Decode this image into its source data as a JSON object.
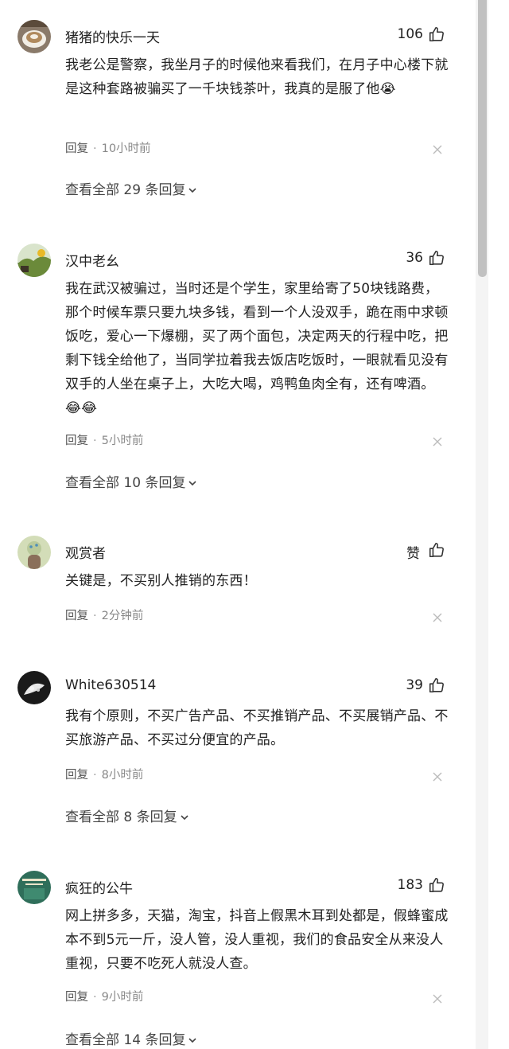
{
  "comments": [
    {
      "username": "猪猪的快乐一天",
      "likes": "106",
      "text": "我老公是警察，我坐月子的时候他来看我们，在月子中心楼下就是这种套路被骗买了一千块钱茶叶，我真的是服了他",
      "emoji": "😭",
      "reply_label": "回复",
      "time": "10小时前",
      "more_replies": "查看全部 29 条回复"
    },
    {
      "username": "汉中老幺",
      "likes": "36",
      "text": "我在武汉被骗过，当时还是个学生，家里给寄了50块钱路费，那个时候车票只要九块多钱，看到一个人没双手，跪在雨中求顿饭吃，爱心一下爆棚，买了两个面包，决定两天的行程中吃，把剩下钱全给他了，当同学拉着我去饭店吃饭时，一眼就看见没有双手的人坐在桌子上，大吃大喝，鸡鸭鱼肉全有，还有啤酒。",
      "emoji": "😂😂",
      "reply_label": "回复",
      "time": "5小时前",
      "more_replies": "查看全部 10 条回复"
    },
    {
      "username": "观赏者",
      "likes": "赞",
      "text": "关键是，不买别人推销的东西！",
      "emoji": "",
      "reply_label": "回复",
      "time": "2分钟前",
      "more_replies": ""
    },
    {
      "username": "White630514",
      "likes": "39",
      "text": "我有个原则，不买广告产品、不买推销产品、不买展销产品、不买旅游产品、不买过分便宜的产品。",
      "emoji": "",
      "reply_label": "回复",
      "time": "8小时前",
      "more_replies": "查看全部 8 条回复"
    },
    {
      "username": "疯狂的公牛",
      "likes": "183",
      "text": "网上拼多多，天猫，淘宝，抖音上假黑木耳到处都是，假蜂蜜成本不到5元一斤，没人管，没人重视，我们的食品安全从来没人重视，只要不吃死人就没人查。",
      "emoji": "",
      "reply_label": "回复",
      "time": "9小时前",
      "more_replies": "查看全部 14 条回复"
    }
  ]
}
